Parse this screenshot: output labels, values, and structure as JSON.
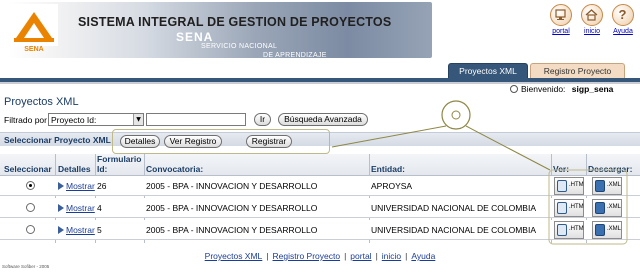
{
  "header": {
    "logo_text": "SENA",
    "system_title": "SISTEMA INTEGRAL DE GESTION DE PROYECTOS",
    "org_short": "SENA",
    "org_line1": "SERVICIO NACIONAL",
    "org_line2": "DE APRENDIZAJE",
    "links": [
      {
        "label": "portal",
        "icon": "portal-icon"
      },
      {
        "label": "inicio",
        "icon": "home-icon"
      },
      {
        "label": "Ayuda",
        "icon": "help-icon"
      }
    ],
    "help_glyph": "?"
  },
  "tabs": [
    {
      "label": "Proyectos XML",
      "active": true
    },
    {
      "label": "Registro Proyecto",
      "active": false
    }
  ],
  "user": {
    "greeting": "Bienvenido:",
    "name": "sigp_sena"
  },
  "page_title": "Proyectos XML",
  "filter": {
    "label": "Filtrado por",
    "selected": "Proyecto Id:",
    "text_value": "",
    "go_label": "Ir",
    "advanced_label": "Búsqueda Avanzada"
  },
  "section": {
    "title": "Seleccionar Proyecto XML",
    "buttons": {
      "details": "Detalles",
      "view": "Ver Registro",
      "register": "Registrar"
    }
  },
  "table": {
    "headers": {
      "select": "Seleccionar",
      "details": "Detalles",
      "form_line1": "Formulario",
      "form_line2": "Id:",
      "call": "Convocatoria:",
      "entity": "Entidad:",
      "view": "Ver:",
      "download": "Descargar:"
    },
    "show_label": "Mostrar",
    "view_file_label": ".HTM",
    "download_file_label": ".XML",
    "rows": [
      {
        "selected": true,
        "form_id": "26",
        "convocatoria": "2005 - BPA - INNOVACION Y DESARROLLO",
        "entidad": "APROYSA"
      },
      {
        "selected": false,
        "form_id": "4",
        "convocatoria": "2005 - BPA - INNOVACION Y DESARROLLO",
        "entidad": "UNIVERSIDAD NACIONAL DE COLOMBIA"
      },
      {
        "selected": false,
        "form_id": "5",
        "convocatoria": "2005 - BPA - INNOVACION Y DESARROLLO",
        "entidad": "UNIVERSIDAD NACIONAL DE COLOMBIA"
      }
    ]
  },
  "footer": {
    "links": [
      "Proyectos XML",
      "Registro Proyecto",
      "portal",
      "inicio",
      "Ayuda"
    ],
    "separator": "|",
    "copyright": "Software Sofiber - 2005"
  },
  "colors": {
    "primary_blue": "#36577a",
    "tab_inactive": "#f3dcc3",
    "annotation_olive": "#8d8744",
    "link_blue": "#1b3d9a",
    "logo_orange": "#e98300"
  }
}
